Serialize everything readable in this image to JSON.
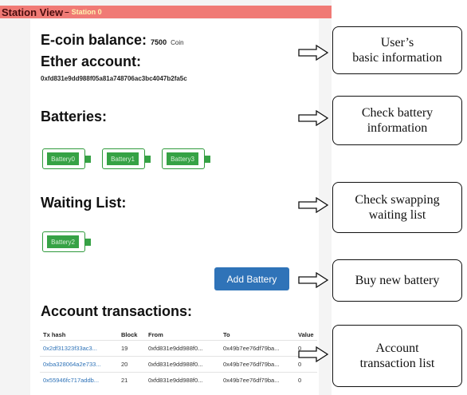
{
  "titlebar": {
    "title": "Station View",
    "sep": "–",
    "subtitle": "Station 0"
  },
  "info": {
    "ecoin_label": "E-coin balance:",
    "ecoin_value": "7500",
    "ecoin_unit": "Coin",
    "ether_label": "Ether account:",
    "ether_address": "0xfd831e9dd988f05a81a748706ac3bc4047b2fa5c"
  },
  "batteries": {
    "heading": "Batteries:",
    "items": [
      "Battery0",
      "Battery1",
      "Battery3"
    ]
  },
  "waiting": {
    "heading": "Waiting List:",
    "items": [
      "Battery2"
    ]
  },
  "add_battery_label": "Add Battery",
  "transactions": {
    "heading": "Account transactions:",
    "columns": [
      "Tx hash",
      "Block",
      "From",
      "To",
      "Value"
    ],
    "rows": [
      [
        "0x2df31323f33ac3...",
        "19",
        "0xfd831e9dd988f0...",
        "0x49b7ee76df79ba...",
        "0"
      ],
      [
        "0xba328064a2e733...",
        "20",
        "0xfd831e9dd988f0...",
        "0x49b7ee76df79ba...",
        "0"
      ],
      [
        "0x55946fc717addb...",
        "21",
        "0xfd831e9dd988f0...",
        "0x49b7ee76df79ba...",
        "0"
      ]
    ]
  },
  "annotations": [
    {
      "line1": "User’s",
      "line2": "basic information"
    },
    {
      "line1": "Check battery",
      "line2": "information"
    },
    {
      "line1": "Check swapping",
      "line2": "waiting list"
    },
    {
      "line1": "Buy new battery",
      "line2": ""
    },
    {
      "line1": "Account",
      "line2": "transaction list"
    }
  ]
}
